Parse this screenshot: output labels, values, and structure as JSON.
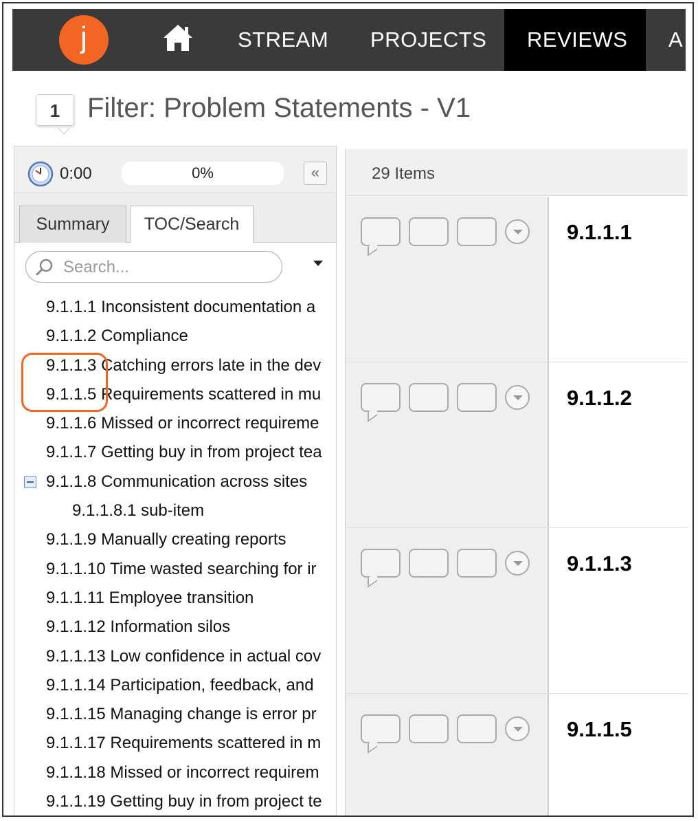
{
  "nav": {
    "logo_letter": "j",
    "items": [
      "STREAM",
      "PROJECTS",
      "REVIEWS",
      "A"
    ],
    "active": "REVIEWS"
  },
  "header": {
    "badge": "1",
    "title": "Filter: Problem Statements - V1"
  },
  "left_panel": {
    "timer": "0:00",
    "progress": "0%",
    "tabs": [
      "Summary",
      "TOC/Search"
    ],
    "search_placeholder": "Search...",
    "toc": [
      {
        "label": "9.1.1.1 Inconsistent documentation a",
        "level": 0
      },
      {
        "label": "9.1.1.2 Compliance",
        "level": 0
      },
      {
        "label": "9.1.1.3 Catching errors late in the dev",
        "level": 0
      },
      {
        "label": "9.1.1.5 Requirements scattered in mu",
        "level": 0
      },
      {
        "label": "9.1.1.6 Missed or incorrect requireme",
        "level": 0
      },
      {
        "label": "9.1.1.7 Getting buy in from project tea",
        "level": 0
      },
      {
        "label": "9.1.1.8 Communication across sites",
        "level": 0,
        "expanded": true
      },
      {
        "label": "9.1.1.8.1 sub-item",
        "level": 1
      },
      {
        "label": "9.1.1.9 Manually creating reports",
        "level": 0
      },
      {
        "label": "9.1.1.10 Time wasted searching for ir",
        "level": 0
      },
      {
        "label": "9.1.1.11 Employee transition",
        "level": 0
      },
      {
        "label": "9.1.1.12 Information silos",
        "level": 0
      },
      {
        "label": "9.1.1.13 Low confidence in actual cov",
        "level": 0
      },
      {
        "label": "9.1.1.14 Participation, feedback, and",
        "level": 0
      },
      {
        "label": "9.1.1.15 Managing change is error pr",
        "level": 0
      },
      {
        "label": "9.1.1.17 Requirements scattered in m",
        "level": 0
      },
      {
        "label": "9.1.1.18 Missed or incorrect requirem",
        "level": 0
      },
      {
        "label": "9.1.1.19 Getting buy in from project te",
        "level": 0
      }
    ]
  },
  "right_panel": {
    "items_count": "29 Items",
    "rows": [
      "9.1.1.1",
      "9.1.1.2",
      "9.1.1.3",
      "9.1.1.5"
    ]
  },
  "colors": {
    "accent": "#f26522",
    "nav_bg": "#3a3a3a",
    "nav_active_bg": "#000000"
  },
  "icons": [
    "home-icon",
    "clock-icon",
    "collapse-icon",
    "search-icon",
    "dropdown-icon",
    "expand-minus-icon",
    "comment-icon",
    "menu-chevron-icon"
  ]
}
